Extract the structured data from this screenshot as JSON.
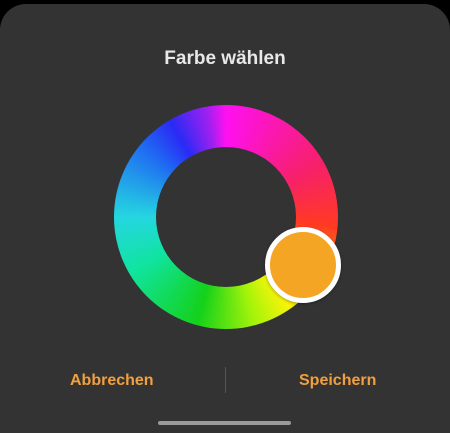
{
  "dialog": {
    "title": "Farbe wählen"
  },
  "color_picker": {
    "selected_color": "#f5a524"
  },
  "actions": {
    "cancel_label": "Abbrechen",
    "save_label": "Speichern"
  },
  "colors": {
    "background": "#333333",
    "accent": "#f0a040",
    "title_text": "#e8e8e8"
  }
}
